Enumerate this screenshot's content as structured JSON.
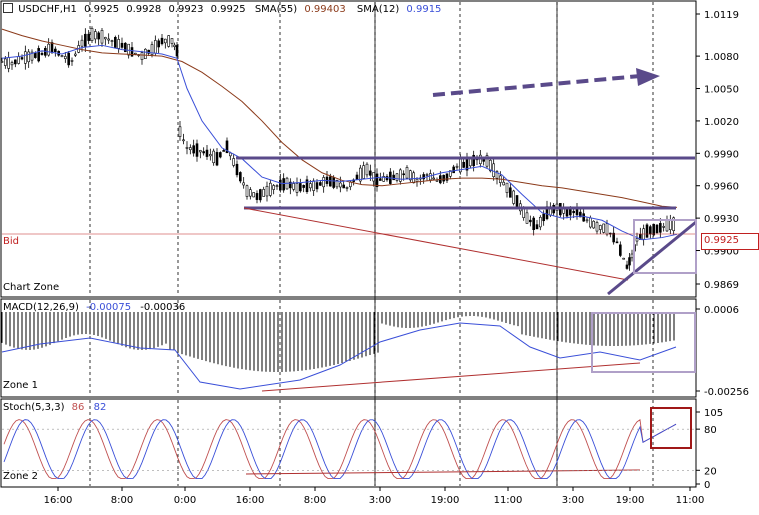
{
  "header": {
    "symbol": "USDCHF,H1",
    "ohlc": [
      "0.9925",
      "0.9928",
      "0.9923",
      "0.9925"
    ],
    "sma55_label": "SMA(55)",
    "sma55_value": "0.99403",
    "sma12_label": "SMA(12)",
    "sma12_value": "0.9915"
  },
  "panes": {
    "main": {
      "name": "Chart Zone",
      "bid_label": "Bid",
      "bid_value": "0.9925",
      "yticks": [
        "1.0119",
        "1.0080",
        "1.0050",
        "1.0020",
        "0.9990",
        "0.9960",
        "0.9930",
        "0.9900",
        "0.9869"
      ]
    },
    "macd": {
      "name": "Zone 1",
      "label": "MACD(12,26,9)",
      "v1": "-0.00075",
      "v2": "-0.00036",
      "yticks": [
        "0.0006",
        "-0.00256"
      ]
    },
    "stoch": {
      "name": "Zone 2",
      "label": "Stoch(5,3,3)",
      "v1": "86",
      "v2": "82",
      "yticks": [
        "105",
        "80",
        "20",
        "0"
      ]
    }
  },
  "xaxis": {
    "ticks": [
      "16:00",
      "8:00",
      "0:00",
      "16:00",
      "8:00",
      "3:00",
      "19:00",
      "11:00",
      "3:00",
      "19:00",
      "11:00"
    ]
  },
  "colors": {
    "price_candle": "#000000",
    "sma55": "#8b3a1a",
    "sma12": "#3a4fd8",
    "annotation": "#5a4a8a",
    "trend_red": "#b03030",
    "highlight_box": "#a020a0",
    "stoch_box": "#a01818"
  },
  "chart_data": [
    {
      "type": "line",
      "title": "USDCHF,H1",
      "ylim": [
        0.9869,
        1.0119
      ],
      "series": [
        {
          "name": "SMA(55)",
          "x": [
            0,
            20,
            40,
            60,
            80,
            100,
            120,
            140,
            160,
            180,
            200,
            220,
            240,
            260,
            280,
            300,
            320,
            340,
            360,
            380,
            400,
            420,
            440,
            460,
            480,
            500,
            520,
            540,
            560,
            580,
            600,
            620,
            640,
            660,
            675
          ],
          "values": [
            1.0105,
            1.0099,
            1.0094,
            1.009,
            1.0086,
            1.0083,
            1.0082,
            1.0081,
            1.008,
            1.0075,
            1.0065,
            1.0052,
            1.0038,
            1.002,
            1.0,
            0.9984,
            0.9972,
            0.9965,
            0.9961,
            0.996,
            0.9962,
            0.9964,
            0.9966,
            0.9967,
            0.9967,
            0.9966,
            0.9963,
            0.996,
            0.9958,
            0.9955,
            0.9952,
            0.9949,
            0.9945,
            0.9941,
            0.994
          ]
        },
        {
          "name": "SMA(12)",
          "x": [
            0,
            20,
            40,
            60,
            80,
            100,
            120,
            140,
            160,
            175,
            185,
            200,
            220,
            240,
            260,
            280,
            300,
            320,
            340,
            360,
            380,
            400,
            420,
            440,
            460,
            480,
            500,
            520,
            540,
            560,
            580,
            600,
            620,
            640,
            660,
            675
          ],
          "values": [
            1.0078,
            1.008,
            1.0085,
            1.0082,
            1.0088,
            1.009,
            1.0086,
            1.0084,
            1.0082,
            1.0078,
            1.005,
            1.002,
            0.9995,
            0.9985,
            0.9968,
            0.9962,
            0.9963,
            0.9965,
            0.9964,
            0.9966,
            0.9968,
            0.9966,
            0.9967,
            0.9972,
            0.9975,
            0.9978,
            0.997,
            0.9952,
            0.9935,
            0.993,
            0.9932,
            0.9928,
            0.9918,
            0.991,
            0.9912,
            0.9915
          ]
        },
        {
          "name": "Price",
          "x": [
            0,
            10,
            20,
            30,
            40,
            50,
            60,
            70,
            80,
            90,
            100,
            110,
            120,
            130,
            140,
            150,
            160,
            170,
            175,
            178,
            185,
            195,
            205,
            215,
            225,
            235,
            245,
            255,
            265,
            275,
            285,
            295,
            305,
            315,
            325,
            335,
            345,
            355,
            365,
            375,
            385,
            395,
            405,
            415,
            425,
            435,
            445,
            455,
            465,
            475,
            485,
            495,
            505,
            515,
            525,
            535,
            545,
            555,
            565,
            575,
            585,
            595,
            605,
            615,
            625,
            630,
            635,
            645,
            655,
            665,
            675
          ],
          "values": [
            1.0075,
            1.0073,
            1.0078,
            1.008,
            1.0082,
            1.0088,
            1.008,
            1.0076,
            1.0092,
            1.01,
            1.0098,
            1.0094,
            1.009,
            1.0084,
            1.008,
            1.0086,
            1.0094,
            1.0094,
            1.0085,
            1.001,
            0.9995,
            0.9993,
            0.999,
            0.9985,
            0.9996,
            0.9975,
            0.9955,
            0.995,
            0.9955,
            0.996,
            0.9962,
            0.9958,
            0.996,
            0.996,
            0.9965,
            0.9962,
            0.9958,
            0.9968,
            0.9975,
            0.9965,
            0.9967,
            0.9968,
            0.9972,
            0.9965,
            0.997,
            0.9965,
            0.9968,
            0.9978,
            0.998,
            0.9985,
            0.9983,
            0.997,
            0.9958,
            0.9945,
            0.993,
            0.9922,
            0.9935,
            0.994,
            0.9935,
            0.9936,
            0.9928,
            0.9922,
            0.992,
            0.9908,
            0.9885,
            0.9895,
            0.991,
            0.9918,
            0.992,
            0.9923,
            0.9925
          ]
        }
      ]
    },
    {
      "type": "bar",
      "title": "MACD(12,26,9)",
      "ylim": [
        -0.00256,
        0.0006
      ]
    },
    {
      "type": "line",
      "title": "Stoch(5,3,3)",
      "ylim": [
        0,
        105
      ]
    }
  ]
}
